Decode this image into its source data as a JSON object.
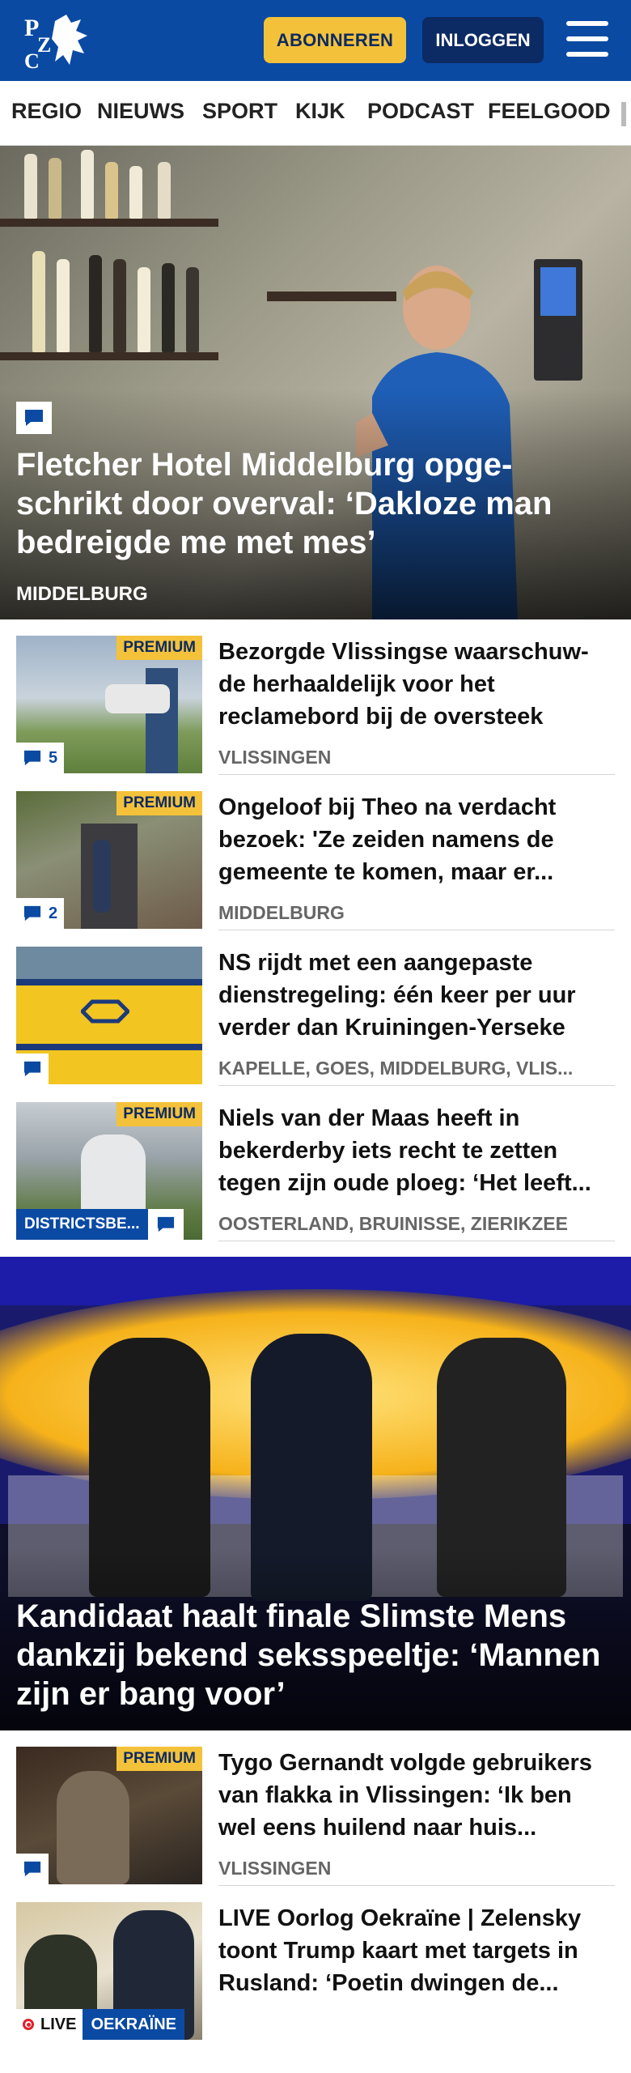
{
  "header": {
    "logo_text": "PZC",
    "subscribe_label": "ABONNEREN",
    "login_label": "INLOGGEN",
    "brand_color": "#0a4aa3",
    "accent_color": "#f4c23a"
  },
  "nav": {
    "items": [
      {
        "label": "REGIO"
      },
      {
        "label": "NIEUWS"
      },
      {
        "label": "SPORT"
      },
      {
        "label": "KIJK"
      },
      {
        "label": "PODCAST"
      },
      {
        "label": "FEELGOOD"
      }
    ]
  },
  "hero": {
    "title": "Fletcher Hotel Middelburg opge­schrikt door overval: ‘Dakloze man bedreigde me met mes’",
    "tag": "MIDDELBURG",
    "icon": "comment-icon"
  },
  "articles": [
    {
      "title": "Bezorgde Vlissingse waarschuw­de herhaaldelijk voor het reclamebord bij de oversteek",
      "tag": "VLISSINGEN",
      "premium": "PREMIUM",
      "comments": "5"
    },
    {
      "title": "Ongeloof bij Theo na verdacht bezoek: 'Ze zeiden namens de gemeente te komen, maar er...",
      "tag": "MIDDELBURG",
      "premium": "PREMIUM",
      "comments": "2"
    },
    {
      "title": "NS rijdt met een aangepaste dienstregeling: één keer per uur verder dan Kruiningen-Yerseke",
      "tag": "KAPELLE, GOES, MIDDELBURG, VLIS...",
      "comments": ""
    },
    {
      "title": "Niels van der Maas heeft in bekerderby iets recht te zetten tegen zijn oude ploeg: ‘Het leeft...",
      "tag": "OOSTERLAND, BRUINISSE, ZIERIKZEE",
      "premium": "PREMIUM",
      "badge": "DISTRICTSBE...",
      "comments": ""
    }
  ],
  "hero2": {
    "title": "Kandidaat haalt finale Slimste Mens dankzij bekend seksspeeltje: ‘Mannen zijn er bang voor’"
  },
  "articles2": [
    {
      "title": "Tygo Gernandt volgde gebruikers van flakka in Vlissingen: ‘Ik ben wel eens huilend naar huis...",
      "tag": "VLISSINGEN",
      "premium": "PREMIUM",
      "comments": ""
    },
    {
      "title": "LIVE Oorlog Oekraïne | Zelensky toont Trump kaart met targets in Rusland: ‘Poetin dwingen de...",
      "live_label": "LIVE",
      "live_topic": "OEKRAÏNE"
    }
  ]
}
